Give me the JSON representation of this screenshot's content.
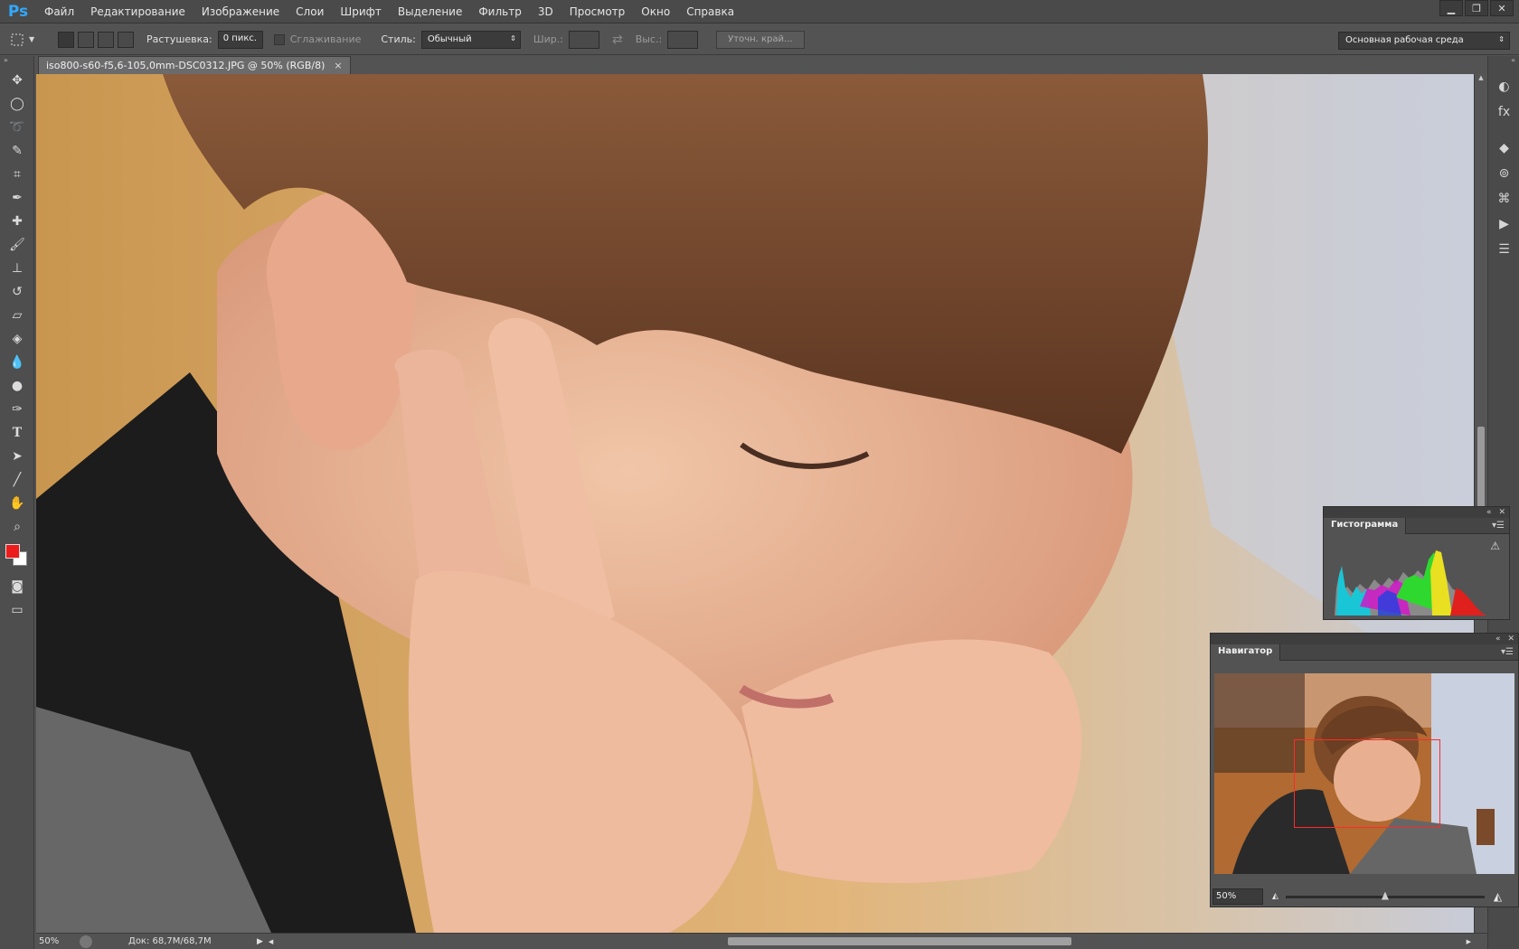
{
  "app": {
    "logo": "Ps"
  },
  "menu": [
    "Файл",
    "Редактирование",
    "Изображение",
    "Слои",
    "Шрифт",
    "Выделение",
    "Фильтр",
    "3D",
    "Просмотр",
    "Окно",
    "Справка"
  ],
  "options": {
    "feather_label": "Растушевка:",
    "feather_value": "0 пикс.",
    "antialias_label": "Сглаживание",
    "style_label": "Стиль:",
    "style_value": "Обычный",
    "width_label": "Шир.:",
    "height_label": "Выс.:",
    "refine_label": "Уточн. край...",
    "workspace": "Основная рабочая среда"
  },
  "document": {
    "tab_title": "iso800-s60-f5,6-105,0mm-DSC0312.JPG @ 50% (RGB/8)",
    "close_glyph": "×"
  },
  "status": {
    "zoom": "50%",
    "doc_info": "Док: 68,7M/68,7M"
  },
  "histogram": {
    "title": "Гистограмма",
    "warning_glyph": "⚠"
  },
  "navigator": {
    "title": "Навигатор",
    "zoom": "50%",
    "zoom_level": 0.5
  },
  "colors": {
    "foreground": "#ed1c1c",
    "background": "#ffffff",
    "accent": "#31a8ff"
  },
  "icons": {
    "tools": [
      "move-tool-icon",
      "marquee-tool-icon",
      "lasso-tool-icon",
      "quick-selection-icon",
      "crop-tool-icon",
      "eyedropper-icon",
      "healing-brush-icon",
      "brush-tool-icon",
      "clone-stamp-icon",
      "history-brush-icon",
      "eraser-icon",
      "paint-bucket-icon",
      "blur-tool-icon",
      "dodge-tool-icon",
      "pen-tool-icon",
      "type-tool-icon",
      "path-selection-icon",
      "line-tool-icon",
      "hand-tool-icon",
      "zoom-tool-icon"
    ],
    "dock": [
      "adjustments-icon",
      "styles-icon",
      "layers-icon",
      "channels-icon",
      "paths-icon",
      "actions-icon",
      "properties-icon"
    ]
  }
}
